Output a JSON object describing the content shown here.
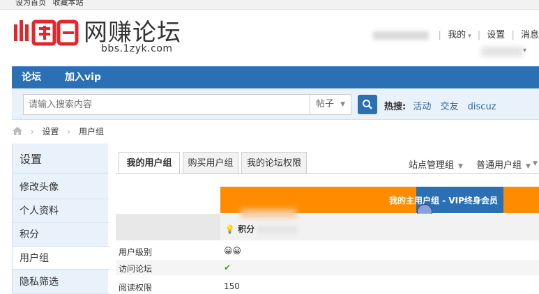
{
  "topbar": {
    "links": [
      "设为首页",
      "收藏本站"
    ]
  },
  "header": {
    "logo_text": "网赚论坛",
    "logo_sub": "bbs.1zyk.com",
    "usernav": [
      "我的",
      "设置",
      "消息"
    ]
  },
  "nav": {
    "items": [
      "论坛",
      "加入vip"
    ]
  },
  "search": {
    "placeholder": "请输入搜索内容",
    "type": "帖子",
    "hot_label": "热搜:",
    "hot_terms": [
      "活动",
      "交友",
      "discuz"
    ]
  },
  "breadcrumb": [
    "设置",
    "用户组"
  ],
  "sidebar": {
    "title": "设置",
    "items": [
      "修改头像",
      "个人资料",
      "积分",
      "用户组",
      "隐私筛选"
    ],
    "active_index": 3
  },
  "tabs": [
    "我的用户组",
    "购买用户组",
    "我的论坛权限"
  ],
  "group_selectors": [
    "站点管理组",
    "普通用户组"
  ],
  "group_header": "我的主用户组 - VIP终身会员",
  "score_label": "积分",
  "rows": [
    {
      "label": "用户级别",
      "value": "😀😀"
    },
    {
      "label": "访问论坛",
      "value": "✔"
    },
    {
      "label": "阅读权限",
      "value": "150"
    }
  ],
  "colors": {
    "nav": "#2b6fb4",
    "orange": "#ff8c00",
    "sidebar": "#e9f2fa"
  }
}
